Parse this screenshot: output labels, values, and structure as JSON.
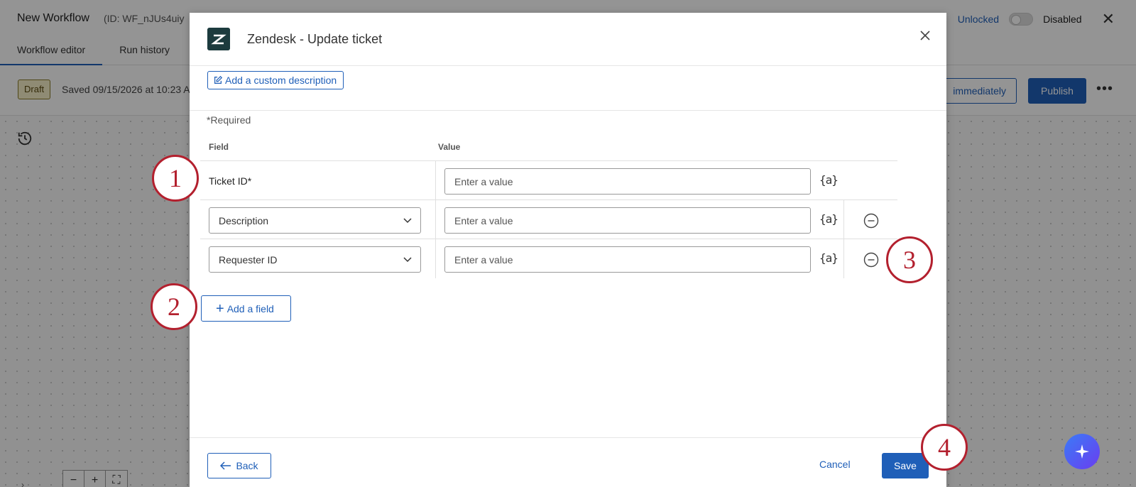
{
  "app": {
    "title": "New Workflow",
    "id_text": "(ID: WF_nJUs4uiy",
    "lock_status": "Unlocked",
    "enabled_label": "Disabled",
    "tabs": [
      "Workflow editor",
      "Run history"
    ],
    "status_badge": "Draft",
    "saved_text": "Saved 09/15/2026 at 10:23 A",
    "run_label": "immediately",
    "publish_label": "Publish"
  },
  "modal": {
    "title": "Zendesk - Update ticket",
    "custom_description_label": "Add a custom description",
    "required_note": "*Required",
    "columns": {
      "field": "Field",
      "value": "Value"
    },
    "rows": [
      {
        "field": "Ticket ID*",
        "value": "",
        "placeholder": "Enter a value",
        "piped_text": "{a}"
      },
      {
        "field": "Description",
        "value": "",
        "placeholder": "Enter a value",
        "piped_text": "{a}"
      },
      {
        "field": "Requester ID",
        "value": "",
        "placeholder": "Enter a value",
        "piped_text": "{a}"
      }
    ],
    "add_field_label": "Add a field",
    "back_label": "Back",
    "cancel_label": "Cancel",
    "save_label": "Save"
  },
  "callouts": [
    "1",
    "2",
    "3",
    "4"
  ],
  "colors": {
    "accent": "#1f5fb8",
    "callout": "#b3202e",
    "zendesk_logo": "#1c3b3e",
    "draft_badge": "#f7efc8"
  },
  "icons": [
    "history-icon",
    "close-icon",
    "edit-icon",
    "chevron-down-icon",
    "remove-icon",
    "plus-icon",
    "arrow-left-icon",
    "sparkle-icon",
    "zendesk-logo"
  ]
}
